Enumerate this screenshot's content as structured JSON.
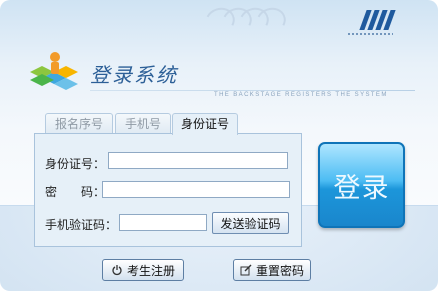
{
  "header": {
    "title": "登录系统",
    "subtitle": "THE BACKSTAGE REGISTERS THE SYSTEM"
  },
  "tabs": [
    {
      "label": "报名序号",
      "active": false
    },
    {
      "label": "手机号",
      "active": false
    },
    {
      "label": "身份证号",
      "active": true
    }
  ],
  "form": {
    "id_label": "身份证号：",
    "id_value": "",
    "password_label": "密　　码：",
    "password_value": "",
    "sms_label": "手机验证码：",
    "sms_value": "",
    "send_code_button": "发送验证码"
  },
  "login_button": "登录",
  "footer": {
    "register_button": "考生注册",
    "reset_button": "重置密码"
  },
  "colors": {
    "accent": "#1c96da",
    "title": "#2c5f97",
    "panel": "#e6f0f8"
  },
  "icons": [
    "logo-icon",
    "power-icon",
    "edit-icon"
  ]
}
